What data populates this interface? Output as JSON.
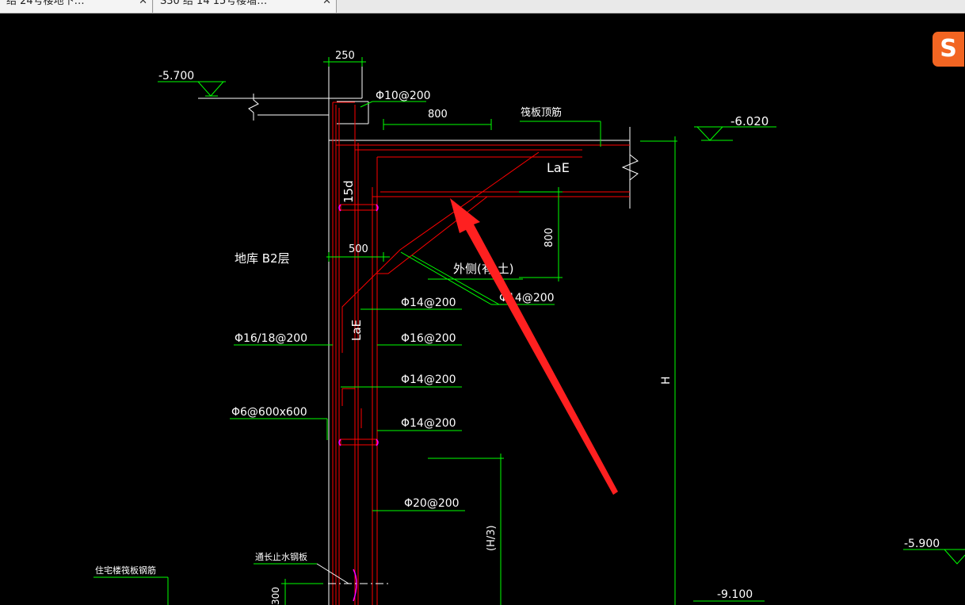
{
  "tabs": [
    {
      "label": "结 24号楼地下…",
      "close": "✕"
    },
    {
      "label": "S30 结 14 15号楼墙…",
      "close": "✕"
    }
  ],
  "ime": {
    "glyph": "S"
  },
  "drawing": {
    "dim_250": "250",
    "elev_top_left": "-5.700",
    "rebar_top": "Φ10@200",
    "dim_800_top": "800",
    "raft_top_bar": "筏板顶筋",
    "elev_right": "-6.020",
    "lae_top": "LaE",
    "dim_15d": "15d",
    "dim_800_side": "800",
    "dim_500": "500",
    "floor_label": "地库 B2层",
    "outer_side": "外侧(有 土)",
    "rebar_14_a": "Φ14@200",
    "rebar_14_b": "Φ14@200",
    "lae_side": "LaE",
    "rebar_16_18": "Φ16/18@200",
    "rebar_16": "Φ16@200",
    "rebar_14_c": "Φ14@200",
    "rebar_6": "Φ6@600x600",
    "rebar_14_d": "Φ14@200",
    "height_H": "H",
    "rebar_20": "Φ20@200",
    "height_H3": "(H/3)",
    "waterstop": "通长止水钢板",
    "residential_rebar": "住宅楼筏板钢筋",
    "elev_right_low": "-5.900",
    "elev_bottom": "-9.100",
    "dim_300_partial": "300"
  },
  "colors": {
    "background": "#000000",
    "green": "#00ff00",
    "red": "#ff0000",
    "white": "#ffffff",
    "magenta": "#ff00ff",
    "annotation_arrow": "#ff2020"
  }
}
